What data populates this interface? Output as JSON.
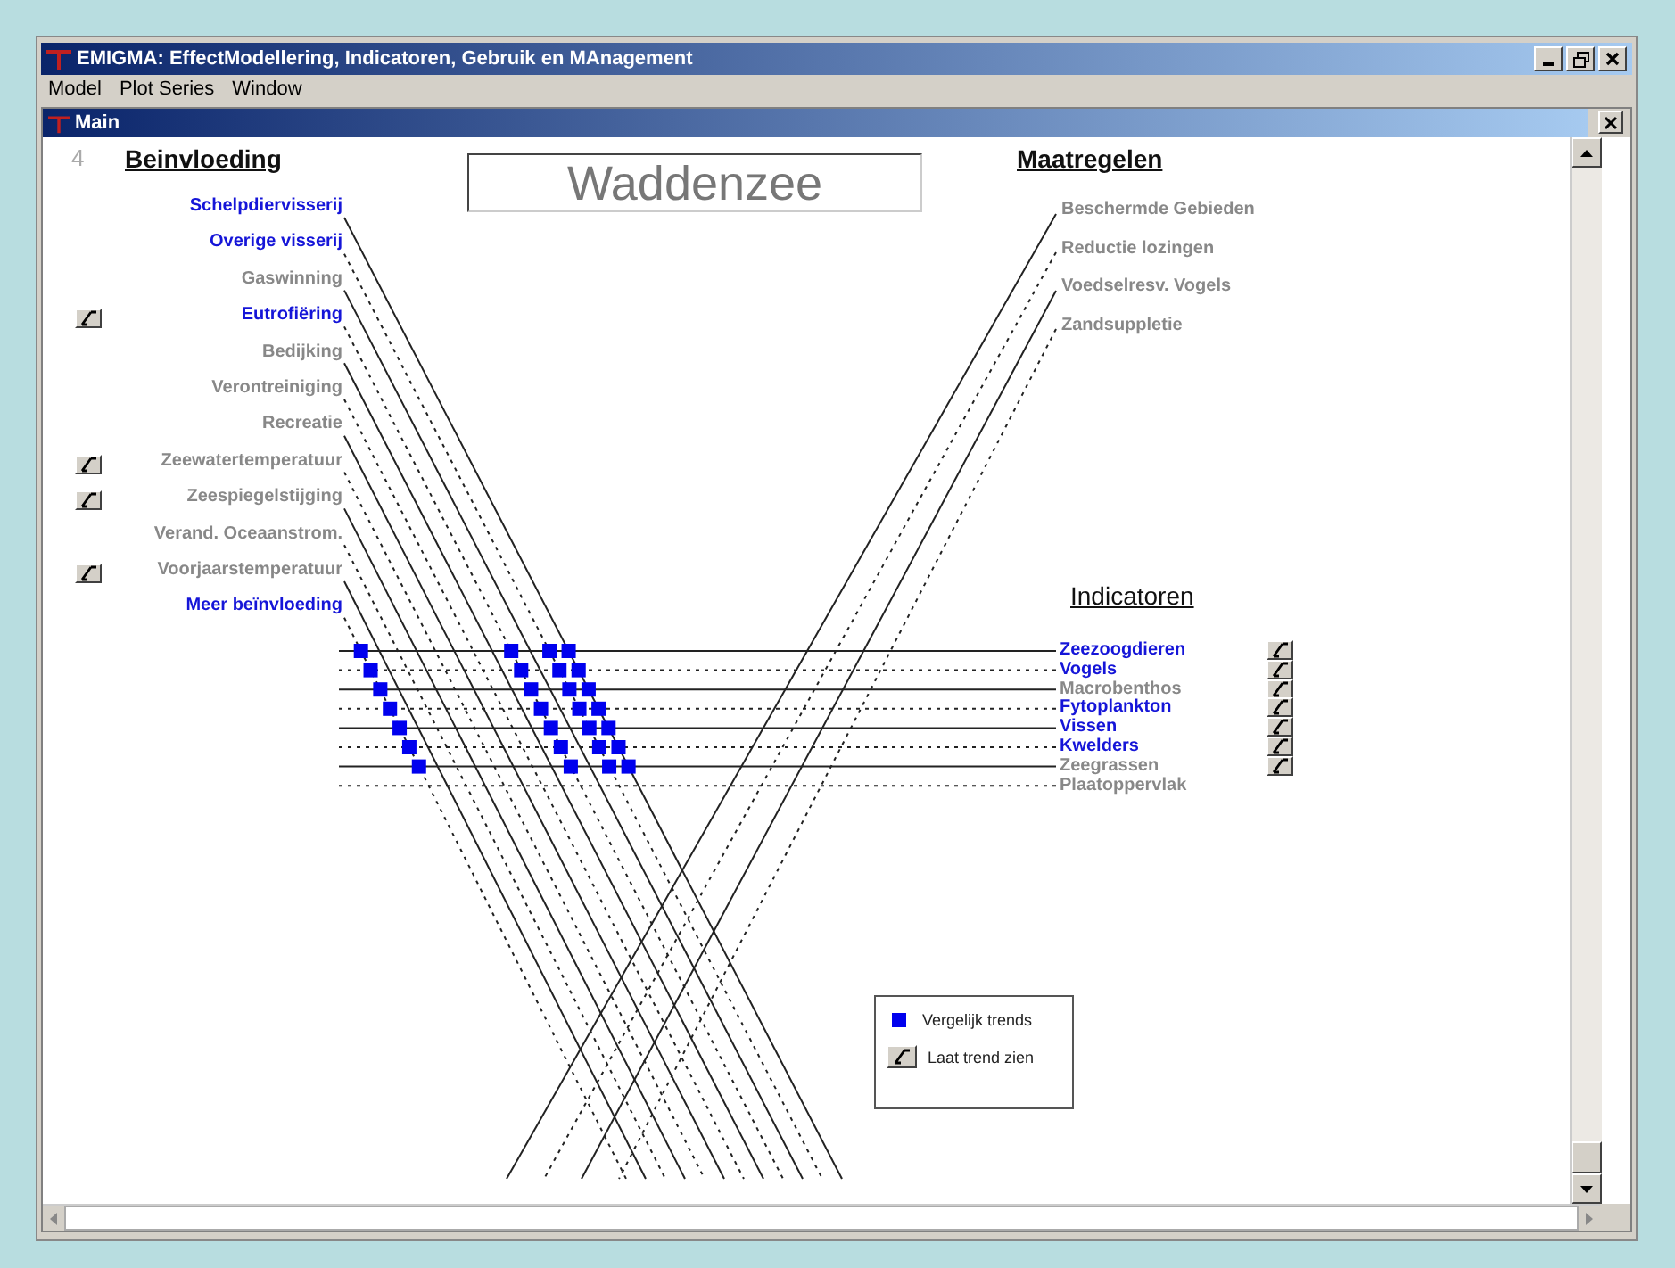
{
  "window": {
    "title": "EMIGMA: EffectModellering, Indicatoren, Gebruik en MAnagement"
  },
  "menu": [
    "Model",
    "Plot Series",
    "Window"
  ],
  "child_window": {
    "title": "Main"
  },
  "page_number": "4",
  "location_title": "Waddenzee",
  "influences": {
    "heading": "Beinvloeding",
    "items": [
      {
        "label": "Schelpdiervisserij",
        "selected": true,
        "trend_button": false
      },
      {
        "label": "Overige visserij",
        "selected": true,
        "trend_button": false
      },
      {
        "label": "Gaswinning",
        "selected": false,
        "trend_button": false
      },
      {
        "label": "Eutrofiëring",
        "selected": true,
        "trend_button": true
      },
      {
        "label": "Bedijking",
        "selected": false,
        "trend_button": false
      },
      {
        "label": "Verontreiniging",
        "selected": false,
        "trend_button": false
      },
      {
        "label": "Recreatie",
        "selected": false,
        "trend_button": false
      },
      {
        "label": "Zeewatertemperatuur",
        "selected": false,
        "trend_button": true
      },
      {
        "label": "Zeespiegelstijging",
        "selected": false,
        "trend_button": true
      },
      {
        "label": "Verand. Oceaanstrom.",
        "selected": false,
        "trend_button": false
      },
      {
        "label": "Voorjaarstemperatuur",
        "selected": false,
        "trend_button": true
      },
      {
        "label": "Meer beïnvloeding",
        "selected": true,
        "trend_button": false
      }
    ]
  },
  "measures": {
    "heading": "Maatregelen",
    "items": [
      {
        "label": "Beschermde Gebieden"
      },
      {
        "label": "Reductie lozingen"
      },
      {
        "label": "Voedselresv. Vogels"
      },
      {
        "label": "Zandsuppletie"
      }
    ]
  },
  "indicators": {
    "heading": "Indicatoren",
    "items": [
      {
        "label": "Zeezoogdieren",
        "selected": true,
        "trend_button": true
      },
      {
        "label": "Vogels",
        "selected": true,
        "trend_button": true
      },
      {
        "label": "Macrobenthos",
        "selected": false,
        "trend_button": true
      },
      {
        "label": "Fytoplankton",
        "selected": true,
        "trend_button": true
      },
      {
        "label": "Vissen",
        "selected": true,
        "trend_button": true
      },
      {
        "label": "Kwelders",
        "selected": true,
        "trend_button": true
      },
      {
        "label": "Zeegrassen",
        "selected": false,
        "trend_button": true
      },
      {
        "label": "Plaatoppervlak",
        "selected": false,
        "trend_button": false
      }
    ]
  },
  "legend": [
    {
      "kind": "marker",
      "label": "Vergelijk trends"
    },
    {
      "kind": "trend",
      "label": "Laat trend zien"
    }
  ]
}
